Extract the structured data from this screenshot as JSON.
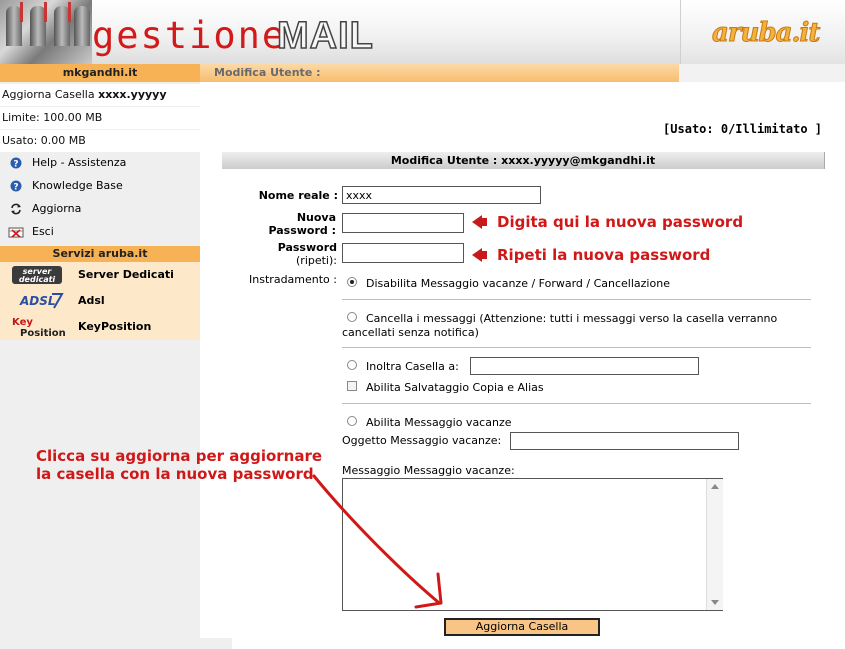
{
  "header": {
    "logo_part1": "gestione",
    "logo_part2": "MAIL",
    "brand": "aruba.it"
  },
  "topbar": {
    "domain": "mkgandhi.it",
    "section_title": "Modifica Utente :"
  },
  "sidebar": {
    "account_prefix": "Aggiorna Casella ",
    "account_name": "xxxx.yyyyy",
    "limit": "Limite: 100.00 MB",
    "used": "Usato: 0.00 MB",
    "links": [
      {
        "label": "Help - Assistenza",
        "icon": "help-icon"
      },
      {
        "label": "Knowledge Base",
        "icon": "help-icon"
      },
      {
        "label": "Aggiorna",
        "icon": "refresh-icon"
      },
      {
        "label": "Esci",
        "icon": "exit-icon"
      }
    ],
    "services_title": "Servizi aruba.it",
    "services": [
      {
        "label": "Server Dedicati",
        "icon_text": "server dedicati"
      },
      {
        "label": "Adsl",
        "icon_text": "ADSL"
      },
      {
        "label": "KeyPosition",
        "icon_text_1": "Key",
        "icon_text_2": "Position"
      }
    ]
  },
  "main": {
    "usage": "[Usato: 0/Illimitato ]",
    "form_title": "Modifica Utente : xxxx.yyyyy@mkgandhi.it",
    "name_label": "Nome reale :",
    "name_value": "xxxx",
    "new_password_label_1": "Nuova",
    "new_password_label_2": "Password :",
    "repeat_password_label_1": "Password",
    "repeat_password_label_2": "(ripeti):",
    "new_password_hint": "Digita qui la nuova password",
    "repeat_password_hint": "Ripeti la nuova password",
    "routing_label": "Instradamento :",
    "options": {
      "disable": "Disabilita Messaggio vacanze / Forward / Cancellazione",
      "delete": "Cancella i messaggi (Attenzione: tutti i messaggi verso la casella verranno cancellati senza notifica)",
      "forward": "Inoltra Casella a:",
      "copy_alias": "Abilita Salvataggio Copia e Alias",
      "vacation": "Abilita Messaggio vacanze"
    },
    "vacation_subject_label": "Oggetto Messaggio vacanze:",
    "vacation_message_label": "Messaggio Messaggio vacanze:",
    "submit_label": "Aggiorna Casella",
    "note": "Clicca su aggiorna per aggiornare la casella con la nuova password"
  },
  "colors": {
    "accent_orange": "#f7b255",
    "annotation_red": "#d01818"
  }
}
